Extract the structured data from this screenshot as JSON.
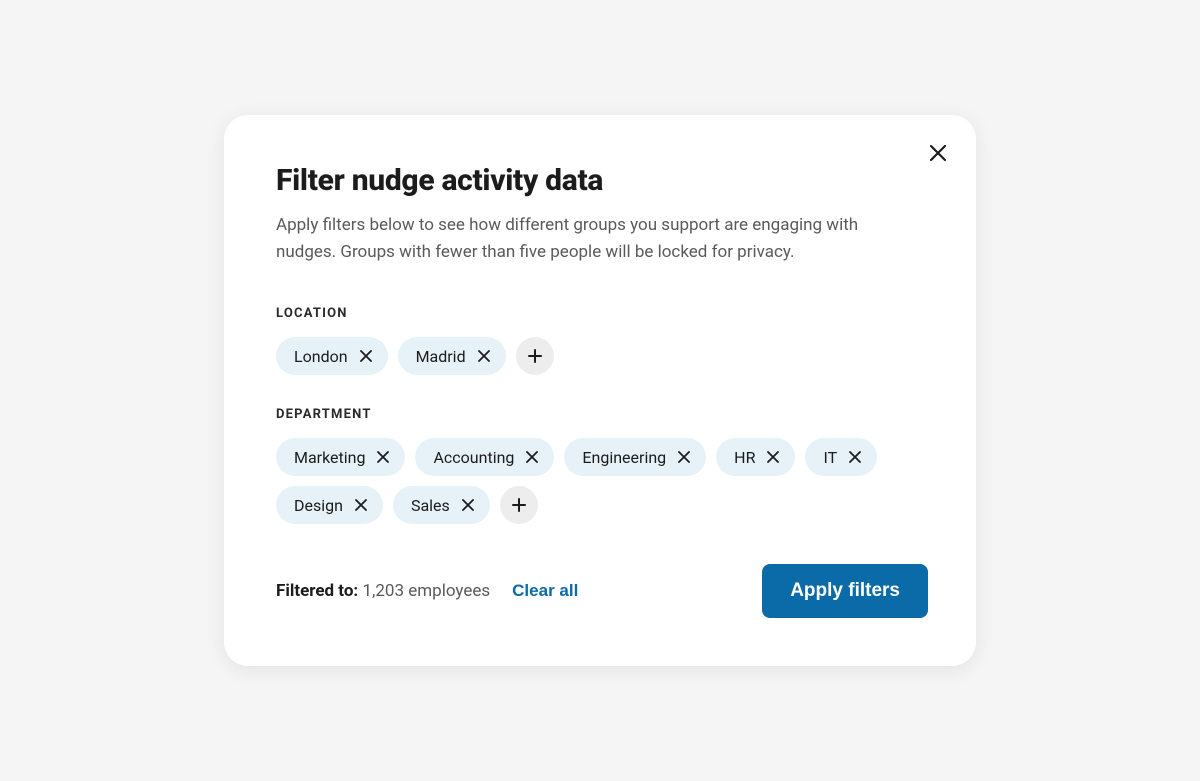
{
  "modal": {
    "title": "Filter nudge activity data",
    "subtitle": "Apply filters below to see how different groups you support are engaging with nudges. Groups with fewer than five people will be locked for privacy."
  },
  "sections": {
    "location": {
      "label": "LOCATION",
      "chips": [
        "London",
        "Madrid"
      ]
    },
    "department": {
      "label": "DEPARTMENT",
      "chips": [
        "Marketing",
        "Accounting",
        "Engineering",
        "HR",
        "IT",
        "Design",
        "Sales"
      ]
    }
  },
  "footer": {
    "filtered_label": "Filtered to:",
    "filtered_value": "1,203 employees",
    "clear_label": "Clear all",
    "apply_label": "Apply filters"
  }
}
